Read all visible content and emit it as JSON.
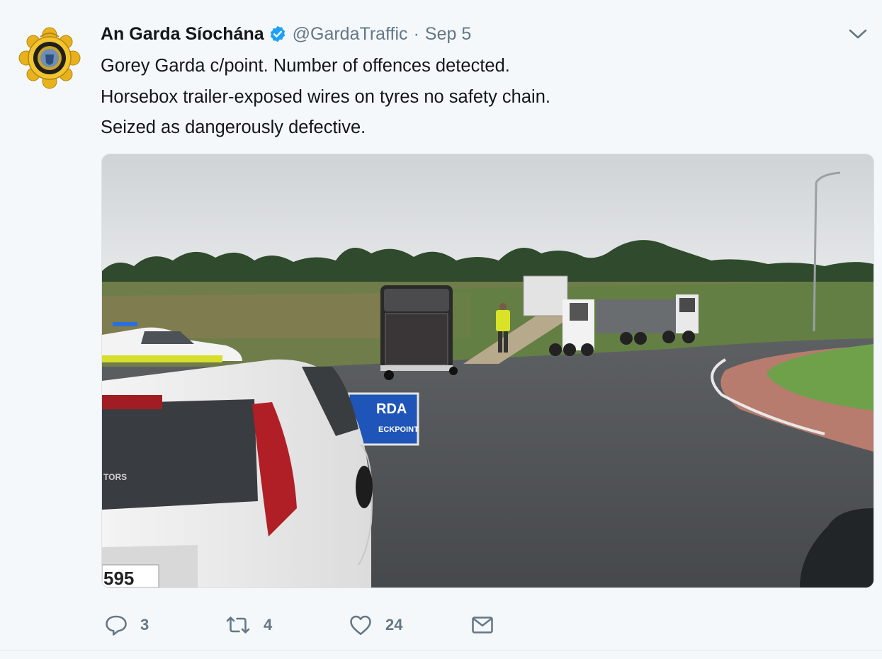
{
  "tweet": {
    "author_name": "An Garda Síochána",
    "handle": "@GardaTraffic",
    "separator": "·",
    "date": "Sep 5",
    "lines": [
      "Gorey Garda c/point. Number of offences detected.",
      "Horsebox trailer-exposed wires on tyres no safety chain.",
      "Seized as dangerously defective."
    ],
    "image": {
      "sign_text": "RDA",
      "sign_subtext": "ECKPOINT",
      "plate_text": "595",
      "dealer_badge": "TORS"
    },
    "actions": {
      "reply_count": "3",
      "retweet_count": "4",
      "like_count": "24"
    }
  },
  "icons": {
    "avatar": "garda-badge-icon",
    "verified": "verified-badge-icon",
    "caret": "chevron-down-icon",
    "reply": "reply-icon",
    "retweet": "retweet-icon",
    "like": "heart-icon",
    "dm": "envelope-icon"
  },
  "colors": {
    "background": "#f5f8fa",
    "text": "#14171a",
    "muted": "#657786",
    "verified": "#1da1f2"
  }
}
